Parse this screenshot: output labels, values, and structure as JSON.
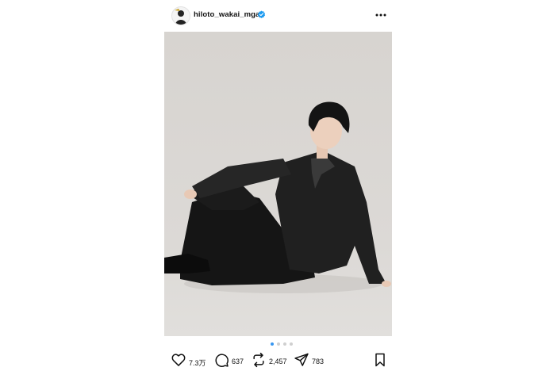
{
  "header": {
    "username": "hiloto_wakai_mga",
    "verified": true
  },
  "carousel": {
    "dot_count": 4,
    "active_index": 0
  },
  "actions": {
    "likes": "7.3万",
    "comments": "637",
    "reposts": "2,457",
    "shares": "783"
  },
  "colors": {
    "accent": "#3897f0",
    "verified": "#1d9bf0",
    "photo_background": "#d9d6d2"
  }
}
